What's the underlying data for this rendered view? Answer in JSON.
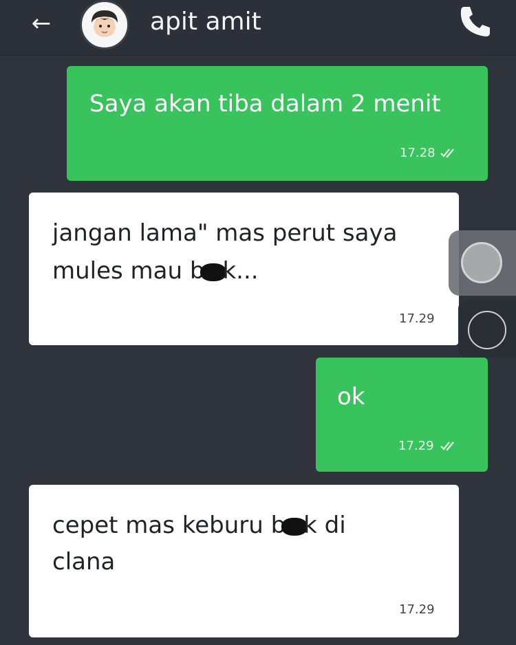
{
  "header": {
    "back_icon": "arrow-left-icon",
    "contact_name": "apit amit",
    "call_icon": "phone-icon"
  },
  "messages": [
    {
      "direction": "outgoing",
      "text": "Saya akan tiba dalam 2 menit",
      "time": "17.28",
      "status_icon": "double-check-icon"
    },
    {
      "direction": "incoming",
      "line1_pre": "jangan lama\" mas perut saya",
      "line2_pre": "mules mau b",
      "line2_post": "k...",
      "time": "17.29"
    },
    {
      "direction": "outgoing",
      "text": "ok",
      "time": "17.29",
      "status_icon": "double-check-icon"
    },
    {
      "direction": "incoming",
      "line1_pre": "cepet mas keburu b",
      "line1_post": "k di",
      "line2_pre": "clana",
      "time": "17.29"
    }
  ],
  "colors": {
    "background": "#2f343c",
    "outgoing_bubble": "#39c35c",
    "incoming_bubble": "#ffffff"
  }
}
